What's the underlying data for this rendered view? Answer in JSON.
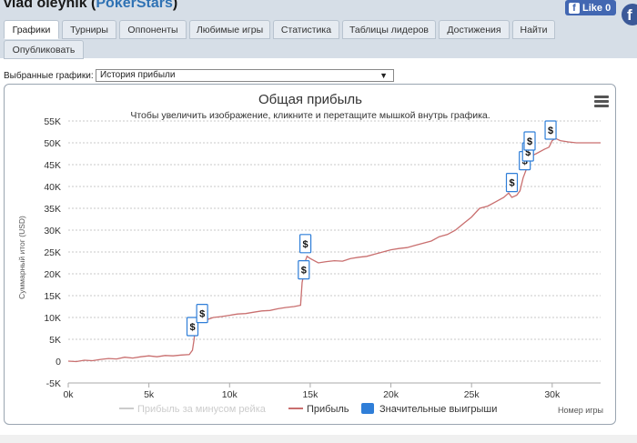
{
  "header": {
    "player_name": "vlad oleynik",
    "site_prefix": "(",
    "site": "PokerStars",
    "site_suffix": ")",
    "like_label": "Like 0",
    "fb_glyph": "f"
  },
  "tabs": [
    {
      "label": "Графики",
      "active": true
    },
    {
      "label": "Турниры",
      "active": false
    },
    {
      "label": "Оппоненты",
      "active": false
    },
    {
      "label": "Любимые игры",
      "active": false
    },
    {
      "label": "Статистика",
      "active": false
    },
    {
      "label": "Таблицы лидеров",
      "active": false
    },
    {
      "label": "Достижения",
      "active": false
    },
    {
      "label": "Найти",
      "active": false
    },
    {
      "label": "Опубликовать",
      "active": false
    }
  ],
  "selector": {
    "label": "Выбранные графики:",
    "value": "История прибыли",
    "arrow": "▼"
  },
  "chart_data": {
    "type": "line",
    "title": "Общая прибыль",
    "subtitle": "Чтобы увеличить изображение, кликните и перетащите мышкой внутрь графика.",
    "xlabel": "Номер игры",
    "ylabel": "Суммарный итог (USD)",
    "xlim": [
      0,
      33000
    ],
    "ylim": [
      -5000,
      55000
    ],
    "x_ticks": [
      "0k",
      "5k",
      "10k",
      "15k",
      "20k",
      "25k",
      "30k"
    ],
    "y_ticks": [
      "-5K",
      "0",
      "5K",
      "10K",
      "15K",
      "20K",
      "25K",
      "30K",
      "35K",
      "40K",
      "45K",
      "50K",
      "55K"
    ],
    "grid": true,
    "legend_position": "bottom",
    "series": [
      {
        "name": "Прибыль за минусом рейка",
        "color": "#cccccc",
        "visible": false,
        "x": [],
        "y": []
      },
      {
        "name": "Прибыль",
        "color": "#c96f6f",
        "x": [
          0,
          500,
          1000,
          1500,
          2000,
          2500,
          3000,
          3500,
          4000,
          4500,
          5000,
          5500,
          6000,
          6500,
          7000,
          7500,
          7700,
          7800,
          7900,
          8000,
          8200,
          8400,
          8600,
          9000,
          9500,
          10000,
          10500,
          11000,
          11500,
          12000,
          12500,
          13000,
          13500,
          14000,
          14400,
          14500,
          14600,
          14700,
          14800,
          15000,
          15500,
          16000,
          16500,
          17000,
          17500,
          18000,
          18500,
          19000,
          19500,
          20000,
          20500,
          21000,
          21500,
          22000,
          22500,
          23000,
          23500,
          24000,
          24500,
          25000,
          25500,
          26000,
          26500,
          27000,
          27300,
          27500,
          27800,
          28000,
          28200,
          28400,
          28500,
          28600,
          28700,
          29000,
          29500,
          29800,
          30000,
          30200,
          30500,
          31000,
          31500,
          32000,
          33000
        ],
        "y": [
          0,
          -100,
          200,
          100,
          400,
          600,
          500,
          900,
          700,
          1000,
          1200,
          1000,
          1300,
          1200,
          1400,
          1500,
          2500,
          5000,
          9000,
          10500,
          11000,
          9000,
          9500,
          10000,
          10200,
          10500,
          10800,
          10900,
          11200,
          11500,
          11600,
          12000,
          12300,
          12500,
          12800,
          18000,
          20000,
          23000,
          24000,
          23500,
          22500,
          22800,
          23000,
          22900,
          23500,
          23800,
          24000,
          24500,
          25000,
          25500,
          25800,
          26000,
          26500,
          27000,
          27500,
          28500,
          29000,
          30000,
          31500,
          33000,
          35000,
          35500,
          36500,
          37500,
          38500,
          37500,
          38000,
          39000,
          42000,
          44000,
          45000,
          46500,
          47000,
          47500,
          48500,
          49000,
          50500,
          51000,
          50500,
          50200,
          50000,
          50000,
          50000
        ]
      },
      {
        "name": "Значительные выигрыши",
        "color": "#2f7ed8",
        "marker_label": "$",
        "x": [
          7700,
          8300,
          14600,
          14700,
          27500,
          28300,
          28500,
          28600,
          29900
        ],
        "y": [
          5000,
          8000,
          18000,
          24000,
          38000,
          43000,
          45000,
          47500,
          50000
        ]
      }
    ]
  }
}
